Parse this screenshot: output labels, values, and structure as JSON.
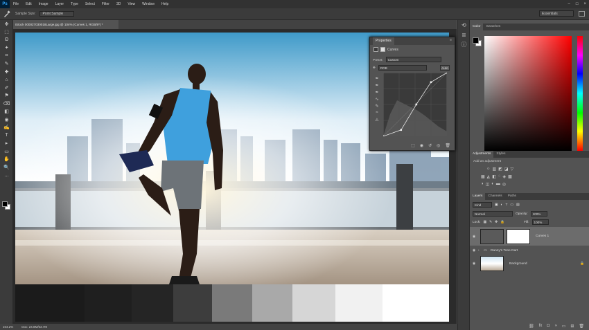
{
  "app": {
    "logo": "Ps"
  },
  "menu": [
    "File",
    "Edit",
    "Image",
    "Layer",
    "Type",
    "Select",
    "Filter",
    "3D",
    "View",
    "Window",
    "Help"
  ],
  "window_buttons": [
    "–",
    "□",
    "×"
  ],
  "options_bar": {
    "tool_icon": "eyedropper-icon",
    "sample_size_label": "Sample Size:",
    "sample_size_value": "Point Sample",
    "workspace": "Essentials"
  },
  "tools": [
    "✥",
    "⬚",
    "ʘ",
    "✦",
    "⌗",
    "✎",
    "✚",
    "⌂",
    "✐",
    "⚑",
    "⌫",
    "◧",
    "◉",
    "✍",
    "T",
    "▸",
    "▭",
    "✋",
    "🔍",
    "…"
  ],
  "document": {
    "tab_title": "iStock 000027030018Large.jpg @ 104% (Curves 1, RGB/8*) *",
    "close": "×"
  },
  "status": {
    "zoom": "104.2%",
    "doc": "Doc: 24.8M/53.7M"
  },
  "swatches": [
    "#1b1b1b",
    "#1f1f1f",
    "#252525",
    "#3d3d3d",
    "#7a7a7a",
    "#a9a9a9",
    "#d6d6d6",
    "#f1f1f1",
    "#ffffff"
  ],
  "properties": {
    "tab": "Properties",
    "menu_icon": "≡",
    "adjustment_name": "Curves",
    "preset_label": "Preset:",
    "preset_value": "Custom",
    "channel_value": "RGB",
    "auto_label": "Auto",
    "curve_points": [
      [
        0,
        0
      ],
      [
        0.28,
        0.1
      ],
      [
        0.52,
        0.5
      ],
      [
        0.75,
        0.85
      ],
      [
        1,
        1
      ]
    ]
  },
  "color_panel": {
    "tabs": [
      "Color",
      "Swatches"
    ],
    "fg": "#000000",
    "bg": "#ffffff"
  },
  "adjustments_panel": {
    "tabs": [
      "Adjustments",
      "Styles"
    ],
    "subtitle": "Add an adjustment"
  },
  "layers_panel": {
    "tabs": [
      "Layers",
      "Channels",
      "Paths"
    ],
    "filter_label": "Kind",
    "blend_mode": "Normal",
    "opacity_label": "Opacity:",
    "opacity_value": "100%",
    "lock_label": "Lock:",
    "fill_label": "Fill:",
    "fill_value": "100%",
    "layers": [
      {
        "name": "Curves 1",
        "kind": "adjustment"
      },
      {
        "name": "Danny's Tone Dart",
        "kind": "group"
      },
      {
        "name": "Background",
        "kind": "image"
      }
    ]
  }
}
